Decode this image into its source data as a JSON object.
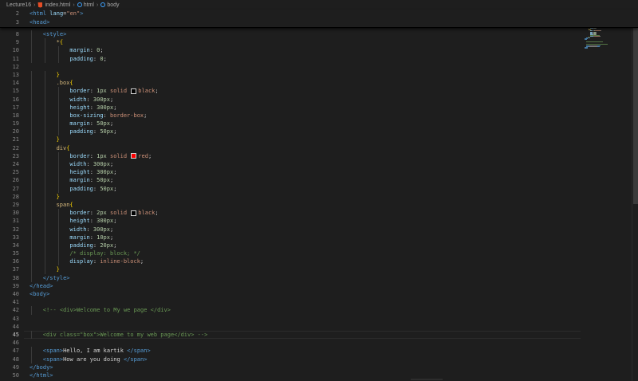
{
  "breadcrumb": {
    "folder": "Lecture16",
    "file": "index.html",
    "item1": "html",
    "item2": "body"
  },
  "sticky_lines": [
    {
      "num": "2",
      "parts": [
        [
          "t-tag",
          "<html "
        ],
        [
          "t-attr",
          "lang"
        ],
        [
          "t-plain",
          "="
        ],
        [
          "t-str",
          "\"en\""
        ],
        [
          "t-tag",
          ">"
        ]
      ]
    },
    {
      "num": "3",
      "parts": [
        [
          "t-tag",
          "<head>"
        ]
      ]
    }
  ],
  "lines": [
    {
      "num": "8",
      "indent": 2,
      "parts": [
        [
          "t-tag",
          "<style>"
        ]
      ]
    },
    {
      "num": "9",
      "indent": 4,
      "parts": [
        [
          "t-sel",
          "*"
        ],
        [
          "t-brace",
          "{"
        ]
      ]
    },
    {
      "num": "10",
      "indent": 6,
      "parts": [
        [
          "t-prop",
          "margin"
        ],
        [
          "t-plain",
          ": "
        ],
        [
          "t-num",
          "0"
        ],
        [
          "t-plain",
          ";"
        ]
      ]
    },
    {
      "num": "11",
      "indent": 6,
      "parts": [
        [
          "t-prop",
          "padding"
        ],
        [
          "t-plain",
          ": "
        ],
        [
          "t-num",
          "0"
        ],
        [
          "t-plain",
          ";"
        ]
      ]
    },
    {
      "num": "12",
      "indent": 0,
      "parts": []
    },
    {
      "num": "13",
      "indent": 4,
      "parts": [
        [
          "t-brace",
          "}"
        ]
      ]
    },
    {
      "num": "14",
      "indent": 4,
      "parts": [
        [
          "t-sel",
          ".box"
        ],
        [
          "t-brace",
          "{"
        ]
      ]
    },
    {
      "num": "15",
      "indent": 6,
      "parts": [
        [
          "t-prop",
          "border"
        ],
        [
          "t-plain",
          ": "
        ],
        [
          "t-num",
          "1px"
        ],
        [
          "t-val",
          " solid "
        ],
        [
          "swatch",
          "#000000"
        ],
        [
          "t-val",
          "black"
        ],
        [
          "t-plain",
          ";"
        ]
      ]
    },
    {
      "num": "16",
      "indent": 6,
      "parts": [
        [
          "t-prop",
          "width"
        ],
        [
          "t-plain",
          ": "
        ],
        [
          "t-num",
          "300px"
        ],
        [
          "t-plain",
          ";"
        ]
      ]
    },
    {
      "num": "17",
      "indent": 6,
      "parts": [
        [
          "t-prop",
          "height"
        ],
        [
          "t-plain",
          ": "
        ],
        [
          "t-num",
          "300px"
        ],
        [
          "t-plain",
          ";"
        ]
      ]
    },
    {
      "num": "18",
      "indent": 6,
      "parts": [
        [
          "t-prop",
          "box-sizing"
        ],
        [
          "t-plain",
          ": "
        ],
        [
          "t-val",
          "border-box"
        ],
        [
          "t-plain",
          ";"
        ]
      ]
    },
    {
      "num": "19",
      "indent": 6,
      "parts": [
        [
          "t-prop",
          "margin"
        ],
        [
          "t-plain",
          ": "
        ],
        [
          "t-num",
          "50px"
        ],
        [
          "t-plain",
          ";"
        ]
      ]
    },
    {
      "num": "20",
      "indent": 6,
      "parts": [
        [
          "t-prop",
          "padding"
        ],
        [
          "t-plain",
          ": "
        ],
        [
          "t-num",
          "50px"
        ],
        [
          "t-plain",
          ";"
        ]
      ]
    },
    {
      "num": "21",
      "indent": 4,
      "parts": [
        [
          "t-brace",
          "}"
        ]
      ]
    },
    {
      "num": "22",
      "indent": 4,
      "parts": [
        [
          "t-sel",
          "div"
        ],
        [
          "t-brace",
          "{"
        ]
      ]
    },
    {
      "num": "23",
      "indent": 6,
      "parts": [
        [
          "t-prop",
          "border"
        ],
        [
          "t-plain",
          ": "
        ],
        [
          "t-num",
          "1px"
        ],
        [
          "t-val",
          " solid "
        ],
        [
          "swatch",
          "#ff0000"
        ],
        [
          "t-val",
          "red"
        ],
        [
          "t-plain",
          ";"
        ]
      ]
    },
    {
      "num": "24",
      "indent": 6,
      "parts": [
        [
          "t-prop",
          "width"
        ],
        [
          "t-plain",
          ": "
        ],
        [
          "t-num",
          "300px"
        ],
        [
          "t-plain",
          ";"
        ]
      ]
    },
    {
      "num": "25",
      "indent": 6,
      "parts": [
        [
          "t-prop",
          "height"
        ],
        [
          "t-plain",
          ": "
        ],
        [
          "t-num",
          "300px"
        ],
        [
          "t-plain",
          ";"
        ]
      ]
    },
    {
      "num": "26",
      "indent": 6,
      "parts": [
        [
          "t-prop",
          "margin"
        ],
        [
          "t-plain",
          ": "
        ],
        [
          "t-num",
          "50px"
        ],
        [
          "t-plain",
          ";"
        ]
      ]
    },
    {
      "num": "27",
      "indent": 6,
      "parts": [
        [
          "t-prop",
          "padding"
        ],
        [
          "t-plain",
          ": "
        ],
        [
          "t-num",
          "50px"
        ],
        [
          "t-plain",
          ";"
        ]
      ]
    },
    {
      "num": "28",
      "indent": 4,
      "parts": [
        [
          "t-brace",
          "}"
        ]
      ]
    },
    {
      "num": "29",
      "indent": 4,
      "parts": [
        [
          "t-sel",
          "span"
        ],
        [
          "t-brace",
          "{"
        ]
      ]
    },
    {
      "num": "30",
      "indent": 6,
      "parts": [
        [
          "t-prop",
          "border"
        ],
        [
          "t-plain",
          ": "
        ],
        [
          "t-num",
          "2px"
        ],
        [
          "t-val",
          " solid "
        ],
        [
          "swatch",
          "#000000"
        ],
        [
          "t-val",
          "black"
        ],
        [
          "t-plain",
          ";"
        ]
      ]
    },
    {
      "num": "31",
      "indent": 6,
      "parts": [
        [
          "t-prop",
          "height"
        ],
        [
          "t-plain",
          ": "
        ],
        [
          "t-num",
          "300px"
        ],
        [
          "t-plain",
          ";"
        ]
      ]
    },
    {
      "num": "32",
      "indent": 6,
      "parts": [
        [
          "t-prop",
          "width"
        ],
        [
          "t-plain",
          ": "
        ],
        [
          "t-num",
          "300px"
        ],
        [
          "t-plain",
          ";"
        ]
      ]
    },
    {
      "num": "33",
      "indent": 6,
      "parts": [
        [
          "t-prop",
          "margin"
        ],
        [
          "t-plain",
          ": "
        ],
        [
          "t-num",
          "10px"
        ],
        [
          "t-plain",
          ";"
        ]
      ]
    },
    {
      "num": "34",
      "indent": 6,
      "parts": [
        [
          "t-prop",
          "padding"
        ],
        [
          "t-plain",
          ": "
        ],
        [
          "t-num",
          "20px"
        ],
        [
          "t-plain",
          ";"
        ]
      ]
    },
    {
      "num": "35",
      "indent": 6,
      "parts": [
        [
          "t-comment",
          "/* display: block; */"
        ]
      ]
    },
    {
      "num": "36",
      "indent": 6,
      "parts": [
        [
          "t-prop",
          "display"
        ],
        [
          "t-plain",
          ": "
        ],
        [
          "t-val",
          "inline-block"
        ],
        [
          "t-plain",
          ";"
        ]
      ]
    },
    {
      "num": "37",
      "indent": 4,
      "parts": [
        [
          "t-brace",
          "}"
        ]
      ]
    },
    {
      "num": "38",
      "indent": 2,
      "parts": [
        [
          "t-tag",
          "</style>"
        ]
      ]
    },
    {
      "num": "39",
      "indent": 0,
      "parts": [
        [
          "t-tag",
          "</head>"
        ]
      ]
    },
    {
      "num": "40",
      "indent": 0,
      "parts": [
        [
          "t-tag",
          "<body>"
        ]
      ]
    },
    {
      "num": "41",
      "indent": 0,
      "parts": []
    },
    {
      "num": "42",
      "indent": 2,
      "parts": [
        [
          "t-comment",
          "<!-- <div>Welcome to My we page </div>"
        ]
      ]
    },
    {
      "num": "43",
      "indent": 0,
      "parts": []
    },
    {
      "num": "44",
      "indent": 0,
      "parts": []
    },
    {
      "num": "45",
      "indent": 2,
      "active": true,
      "parts": [
        [
          "t-comment",
          "<div class=\"box\">Welcome to my web page</div> -->"
        ]
      ]
    },
    {
      "num": "46",
      "indent": 0,
      "parts": []
    },
    {
      "num": "47",
      "indent": 2,
      "parts": [
        [
          "t-tag",
          "<span>"
        ],
        [
          "t-plain",
          "Hello, I am kartik "
        ],
        [
          "t-tag",
          "</span>"
        ]
      ]
    },
    {
      "num": "48",
      "indent": 2,
      "parts": [
        [
          "t-tag",
          "<span>"
        ],
        [
          "t-plain",
          "How are you doing "
        ],
        [
          "t-tag",
          "</span>"
        ]
      ]
    },
    {
      "num": "49",
      "indent": 0,
      "parts": [
        [
          "t-tag",
          "</body>"
        ]
      ]
    },
    {
      "num": "50",
      "indent": 0,
      "parts": [
        [
          "t-tag",
          "</html>"
        ]
      ]
    }
  ]
}
